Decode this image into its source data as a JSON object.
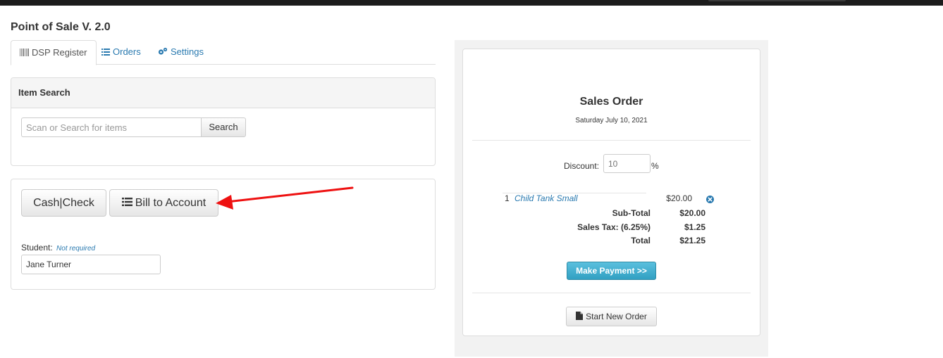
{
  "app": {
    "title": "Point of Sale V. 2.0"
  },
  "tabs": [
    {
      "label": "DSP Register",
      "icon": "barcode-icon",
      "active": true
    },
    {
      "label": "Orders",
      "icon": "list-icon",
      "active": false
    },
    {
      "label": "Settings",
      "icon": "gears-icon",
      "active": false
    }
  ],
  "item_search": {
    "heading": "Item Search",
    "placeholder": "Scan or Search for items",
    "value": "",
    "button": "Search"
  },
  "payment": {
    "cash_check_label": "Cash|Check",
    "bill_account_label": "Bill to Account",
    "bill_account_icon": "list-icon",
    "student_label": "Student:",
    "student_hint": "Not required",
    "student_value": "Jane Turner"
  },
  "annotation": {
    "arrow_color": "#ee1111",
    "points_to": "bill-to-account-button"
  },
  "sales_order": {
    "title": "Sales Order",
    "date": "Saturday July 10, 2021",
    "discount_label": "Discount:",
    "discount_placeholder": "10",
    "discount_suffix": "%",
    "items": [
      {
        "qty": "1",
        "name": "Child Tank Small",
        "price": "$20.00",
        "remove_icon": "remove-circle-icon"
      }
    ],
    "subtotal_label": "Sub-Total",
    "subtotal_value": "$20.00",
    "tax_label": "Sales Tax: (6.25%)",
    "tax_value": "$1.25",
    "total_label": "Total",
    "total_value": "$21.25",
    "make_payment_label": "Make Payment >>",
    "start_new_order_label": "Start New Order",
    "start_new_order_icon": "file-icon"
  },
  "colors": {
    "link": "#2a7ab0",
    "primary_button": "#5bc0de",
    "arrow": "#ee1111"
  }
}
